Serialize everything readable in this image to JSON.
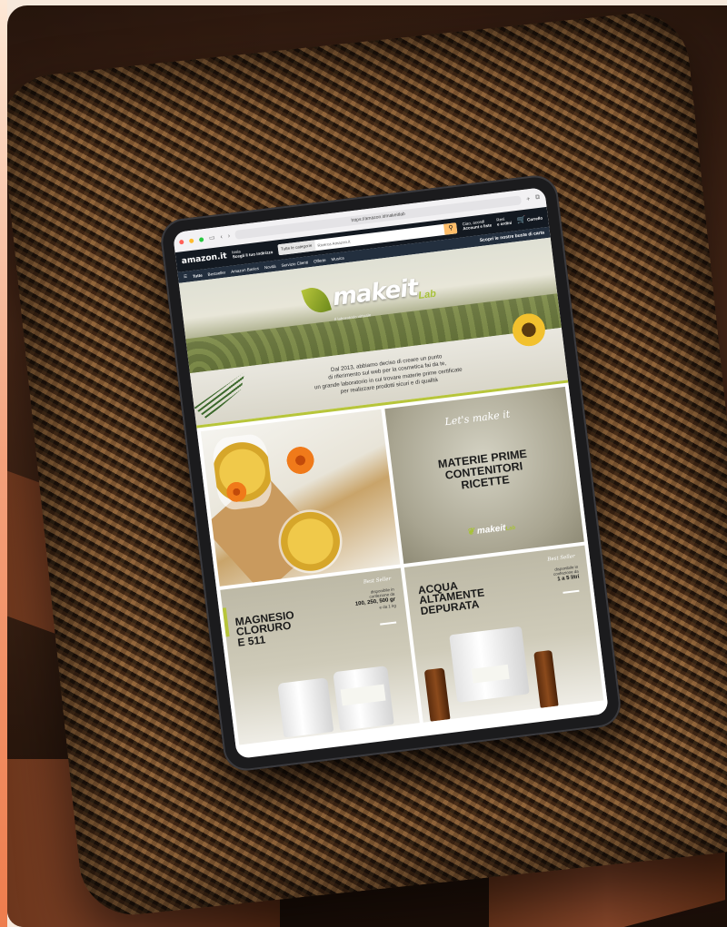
{
  "browser": {
    "url": "https://amazon.it/makeitlab"
  },
  "amazon": {
    "logo": "amazon.it",
    "deliver_line1": "Invia",
    "deliver_line2": "Scegli il tuo indirizzo",
    "search_category": "Tutte le categorie",
    "search_placeholder": "Ricerca Amazon.it",
    "account_line1": "Ciao, accedi",
    "account_line2": "Account e liste",
    "orders_line1": "Resi",
    "orders_line2": "e ordini",
    "cart": "Carrello",
    "nav_items": [
      "Tutte",
      "Bestseller",
      "Amazon Basics",
      "Novità",
      "Servizio Clienti",
      "Offerte",
      "Musica"
    ],
    "promo": "Scopri le nostre buste di carta"
  },
  "store": {
    "brand": "makeit",
    "brand_suffix": "Lab",
    "brand_tagline": "Il laboratorio virtuale",
    "intro_lines": [
      "Dal 2013, abbiamo deciso di creare un punto",
      "di riferimento sul web per la cosmetica fai da te,",
      "un grande laboratorio in cui trovare materie prime certificate",
      "per realizzare prodotti sicuri e di qualità"
    ],
    "tile_makeit": {
      "lets": "Let's make it",
      "line1": "MATERIE PRIME",
      "line2": "CONTENITORI",
      "line3": "RICETTE",
      "logo": "makeit",
      "logo_suffix": "Lab"
    },
    "products": [
      {
        "title_line1": "MAGNESIO",
        "title_line2": "CLORURO",
        "title_line3": "E 511",
        "badge": "Best Seller",
        "avail_line1": "disponibile in",
        "avail_line2": "confezione da",
        "avail_line3": "100, 250, 500 gr",
        "avail_line4": "e da 1 kg"
      },
      {
        "title_line1": "ACQUA",
        "title_line2": "ALTAMENTE",
        "title_line3": "DEPURATA",
        "badge": "Best Seller",
        "avail_line1": "disponibile in",
        "avail_line2": "confezione da",
        "avail_line3": "1 a 5 litri",
        "avail_line4": ""
      }
    ]
  }
}
